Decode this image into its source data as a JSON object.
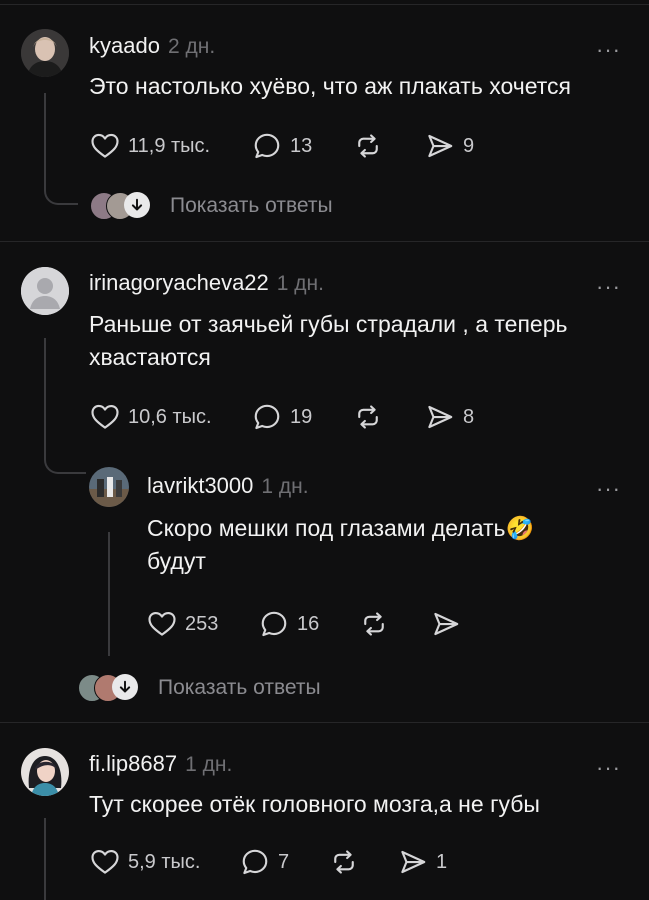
{
  "comments": [
    {
      "username": "kyaado",
      "time": "2 дн.",
      "text": "Это настолько хуёво, что аж плакать хочется",
      "likes": "11,9 тыс.",
      "replies": "13",
      "shares": "9",
      "show_replies": "Показать ответы",
      "avatar_icon": "user-photo-icon"
    },
    {
      "username": "irinagoryacheva22",
      "time": "1 дн.",
      "text": "Раньше от заячьей губы страдали , а теперь хвастаются",
      "likes": "10,6 тыс.",
      "replies": "19",
      "shares": "8",
      "avatar_icon": "default-avatar-icon"
    },
    {
      "username": "fi.lip8687",
      "time": "1 дн.",
      "text": "Тут скорее отёк головного мозга,а не губы",
      "likes": "5,9 тыс.",
      "replies": "7",
      "shares": "1",
      "avatar_icon": "user-photo-icon"
    }
  ],
  "reply": {
    "username": "lavrikt3000",
    "time": "1 дн.",
    "text": "Скоро мешки под глазами делать🤣 будут",
    "likes": "253",
    "replies": "16",
    "show_replies": "Показать ответы"
  },
  "more_label": "···",
  "colors": {
    "background": "#0f0f10",
    "muted": "#6f6f73",
    "text": "#f2f2f2"
  }
}
